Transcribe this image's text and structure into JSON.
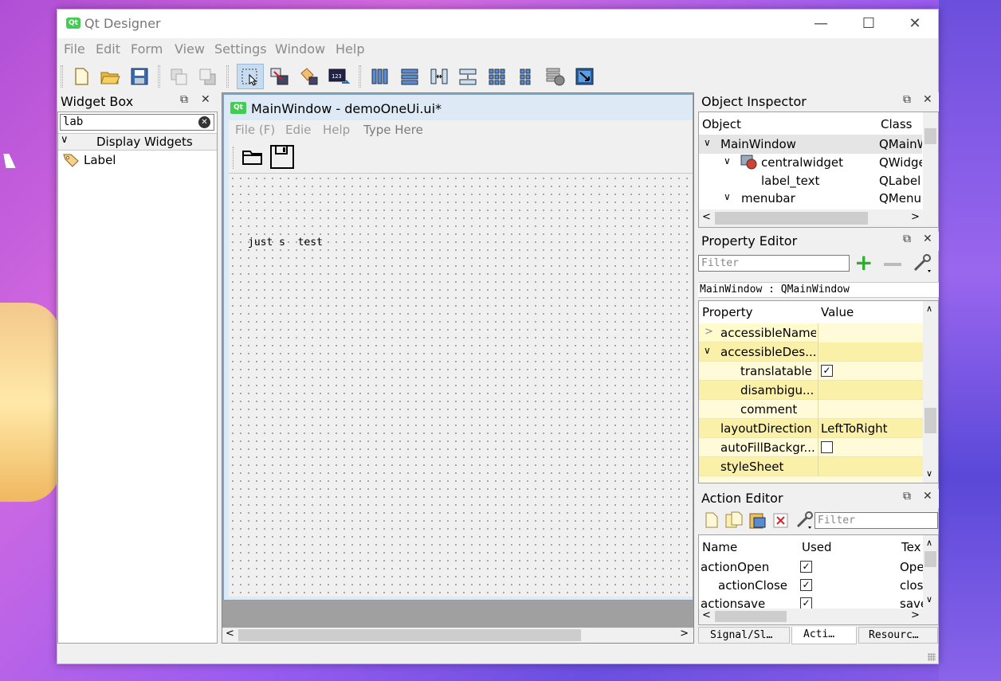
{
  "window": {
    "title": "Qt Designer",
    "logo": "Qt"
  },
  "menu": [
    "File",
    "Edit",
    "Form",
    "View",
    "Settings",
    "Window",
    "Help"
  ],
  "widget_box": {
    "title": "Widget Box",
    "filter_value": "lab",
    "category": "Display Widgets",
    "items": [
      "Label"
    ]
  },
  "form": {
    "tab_logo": "Qt",
    "title": "MainWindow - demoOneUi.ui*",
    "menu": [
      "File (F)",
      "Edie",
      "Help",
      "Type Here"
    ],
    "label_text": "just s  test"
  },
  "object_inspector": {
    "title": "Object Inspector",
    "col_object": "Object",
    "col_class": "Class",
    "rows": [
      {
        "name": "MainWindow",
        "class": "QMainW"
      },
      {
        "name": "centralwidget",
        "class": "QWidge"
      },
      {
        "name": "label_text",
        "class": "QLabel"
      },
      {
        "name": "menubar",
        "class": "QMenu"
      }
    ]
  },
  "property_editor": {
    "title": "Property Editor",
    "filter_placeholder": "Filter",
    "object_label": "MainWindow : QMainWindow",
    "col_property": "Property",
    "col_value": "Value",
    "rows": [
      {
        "name": "accessibleName",
        "value": ""
      },
      {
        "name": "accessibleDes...",
        "value": ""
      },
      {
        "name": "translatable",
        "value": "checked"
      },
      {
        "name": "disambigu...",
        "value": ""
      },
      {
        "name": "comment",
        "value": ""
      },
      {
        "name": "layoutDirection",
        "value": "LeftToRight"
      },
      {
        "name": "autoFillBackgr...",
        "value": "unchecked"
      },
      {
        "name": "styleSheet",
        "value": ""
      }
    ]
  },
  "action_editor": {
    "title": "Action Editor",
    "filter_placeholder": "Filter",
    "col_name": "Name",
    "col_used": "Used",
    "col_text": "Tex",
    "rows": [
      {
        "name": "actionOpen",
        "text": "Ope"
      },
      {
        "name": "actionClose",
        "text": "clos"
      },
      {
        "name": "actionsave",
        "text": "save"
      }
    ]
  },
  "bottom_tabs": [
    "Signal/Sl…",
    "Acti…",
    "Resourc…"
  ]
}
